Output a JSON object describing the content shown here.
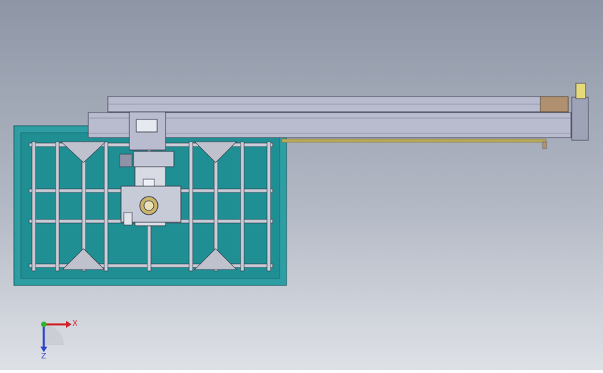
{
  "colors": {
    "bg_top": "#8e96a6",
    "bg_mid": "#b2b8c4",
    "bg_bottom": "#dee1e6",
    "table_outer": "#2d9ea3",
    "table_inner": "#1f8f94",
    "frame": "#c9ccd6",
    "beam": "#b9bccf",
    "beam_dark": "#9fa3b8",
    "motor_plate": "#b0906e",
    "rail": "#b7a95c",
    "axis_x": "#d0242b",
    "axis_y": "#2fb52d",
    "axis_z": "#2c44c9"
  },
  "triad": {
    "x_label": "X",
    "z_label": "Z"
  }
}
